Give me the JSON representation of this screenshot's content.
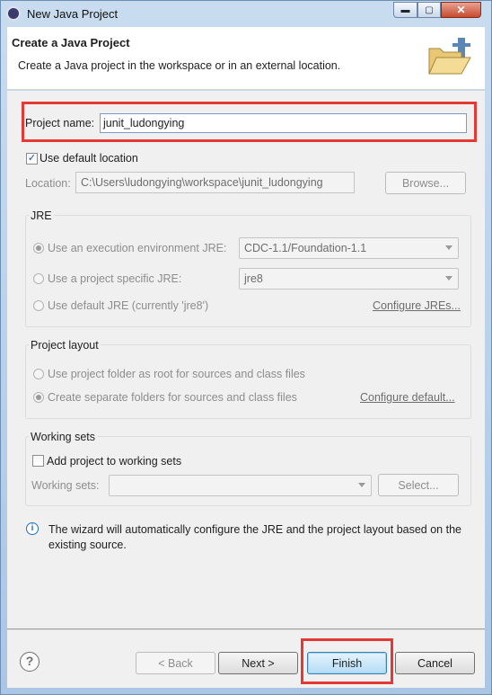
{
  "window": {
    "title": "New Java Project",
    "min_label": "▬",
    "max_label": "▢",
    "close_label": "✕"
  },
  "banner": {
    "title": "Create a Java Project",
    "description": "Create a Java project in the workspace or in an external location."
  },
  "project": {
    "name_label": "Project name:",
    "name_value": "junit_ludongying"
  },
  "location": {
    "use_default_label": "Use default location",
    "use_default_checked": true,
    "label": "Location:",
    "value": "C:\\Users\\ludongying\\workspace\\junit_ludongying",
    "browse_label": "Browse..."
  },
  "jre": {
    "title": "JRE",
    "exec_env_label": "Use an execution environment JRE:",
    "exec_env_value": "CDC-1.1/Foundation-1.1",
    "specific_label": "Use a project specific JRE:",
    "specific_value": "jre8",
    "default_label": "Use default JRE (currently 'jre8')",
    "configure_link": "Configure JREs..."
  },
  "layout": {
    "title": "Project layout",
    "root_label": "Use project folder as root for sources and class files",
    "separate_label": "Create separate folders for sources and class files",
    "configure_link": "Configure default..."
  },
  "working_sets": {
    "title": "Working sets",
    "add_label": "Add project to working sets",
    "sets_label": "Working sets:",
    "sets_value": "",
    "select_label": "Select..."
  },
  "info": {
    "text": "The wizard will automatically configure the JRE and the project layout based on the existing source."
  },
  "footer": {
    "help_glyph": "?",
    "back_label": "< Back",
    "next_label": "Next >",
    "finish_label": "Finish",
    "cancel_label": "Cancel"
  },
  "colors": {
    "highlight": "#e53935",
    "link_disabled": "#6d6d6d"
  }
}
